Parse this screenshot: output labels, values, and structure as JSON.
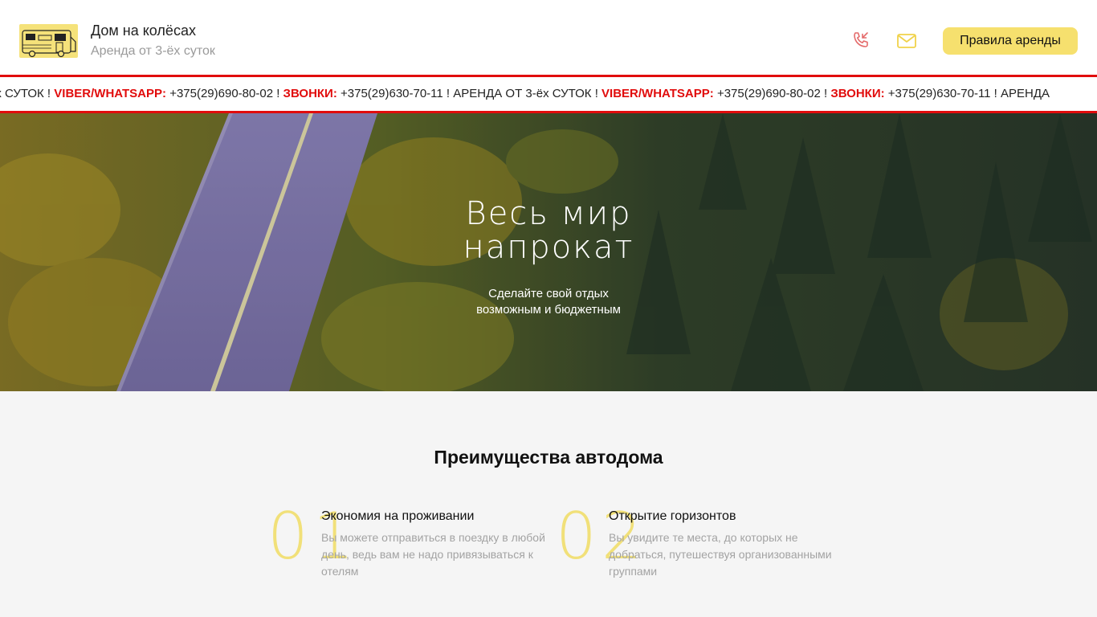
{
  "header": {
    "title": "Дом на колёсах",
    "subtitle": "Аренда от 3-ёх суток",
    "rules_button": "Правила аренды",
    "icons": {
      "phone": "phone-incoming-icon",
      "mail": "mail-icon"
    }
  },
  "ticker": {
    "segments": [
      {
        "text": "ёх СУТОК ! ",
        "red": false
      },
      {
        "text": "VIBER/WHATSAPP: ",
        "red": true
      },
      {
        "text": "+375(29)690-80-02 ! ",
        "red": false
      },
      {
        "text": "ЗВОНКИ: ",
        "red": true
      },
      {
        "text": "+375(29)630-70-11 ! АРЕНДА ОТ 3-ёх СУТОК ! ",
        "red": false
      },
      {
        "text": "VIBER/WHATSAPP: ",
        "red": true
      },
      {
        "text": "+375(29)690-80-02 ! ",
        "red": false
      },
      {
        "text": "ЗВОНКИ: ",
        "red": true
      },
      {
        "text": "+375(29)630-70-11 ! АРЕНДА",
        "red": false
      }
    ]
  },
  "hero": {
    "title_line1": "Весь мир",
    "title_line2": "напрокат",
    "sub_line1": "Сделайте свой отдых",
    "sub_line2": "возможным и бюджетным"
  },
  "advantages": {
    "title": "Преимущества автодома",
    "items": [
      {
        "number": "01",
        "title": "Экономия на проживании",
        "text": "Вы можете отправиться в поездку в любой день, ведь вам не надо привязываться к отелям"
      },
      {
        "number": "02",
        "title": "Открытие горизонтов",
        "text": "Вы увидите те места, до которых не добраться, путешествуя организованными группами"
      }
    ]
  },
  "colors": {
    "accent_yellow": "#f6e06e",
    "ticker_red": "#e10c0c"
  }
}
